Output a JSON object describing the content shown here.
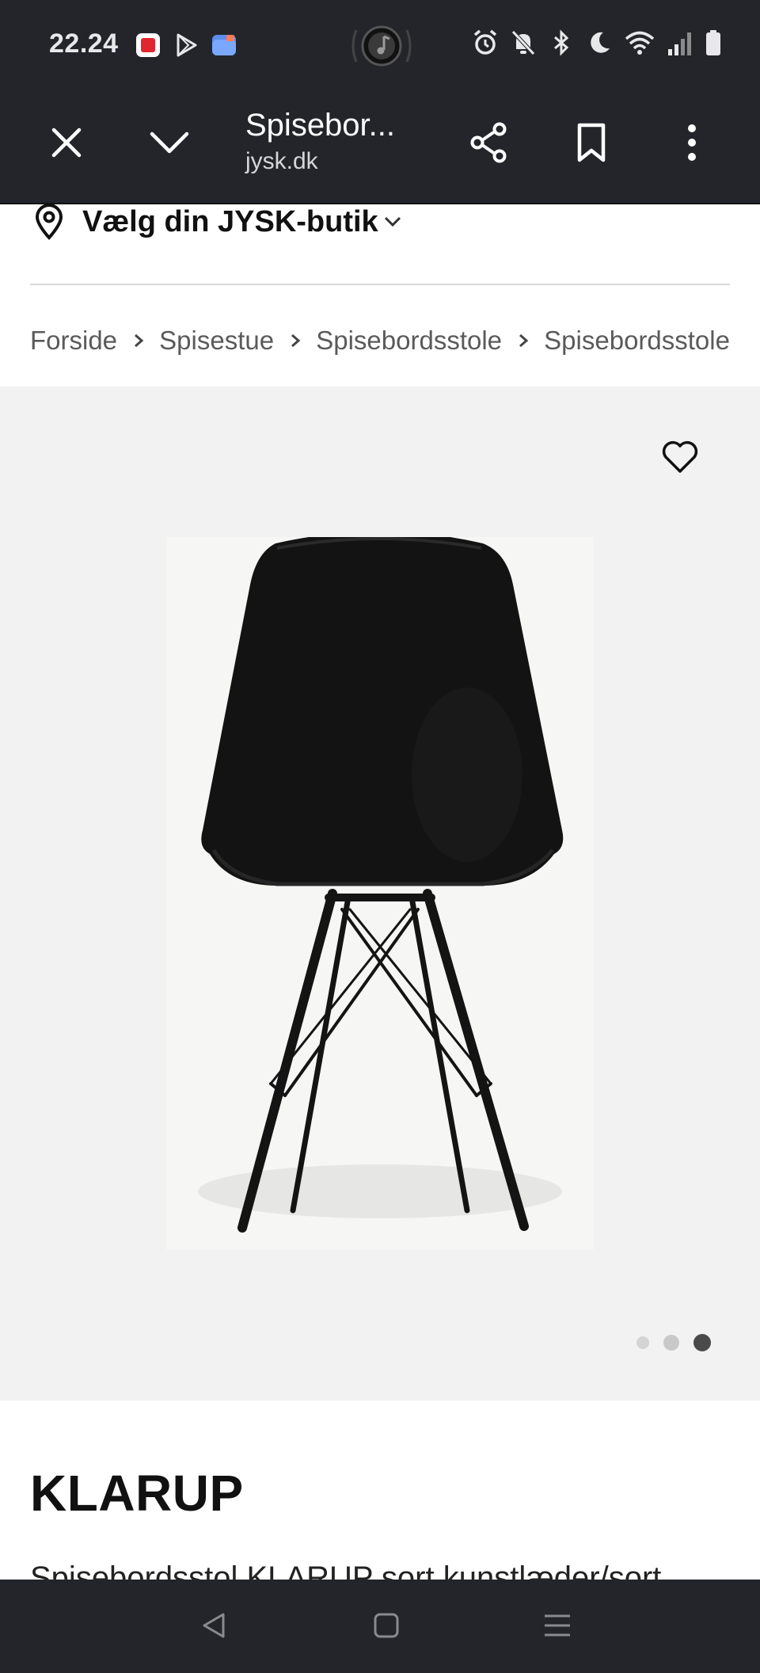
{
  "status_bar": {
    "time": "22.24",
    "notification_icons": [
      "pdf-app-icon",
      "play-store-icon",
      "files-app-icon"
    ],
    "media_icon": "music-note-icon",
    "system_icons": [
      "alarm-icon",
      "bell-off-icon",
      "bluetooth-icon",
      "moon-icon",
      "wifi-icon",
      "signal-icon",
      "battery-icon"
    ]
  },
  "browser_toolbar": {
    "title": "Spisebor...",
    "domain": "jysk.dk",
    "close_icon": "close-icon",
    "minimize_icon": "chevron-down-icon",
    "share_icon": "share-icon",
    "bookmark_icon": "bookmark-icon",
    "menu_icon": "more-vert-icon"
  },
  "store_selector": {
    "label": "Vælg din JYSK-butik",
    "icon": "location-pin-icon"
  },
  "breadcrumb": {
    "items": [
      "Forside",
      "Spisestue",
      "Spisebordsstole",
      "Spisebordsstole"
    ]
  },
  "gallery": {
    "favorite_icon": "heart-icon",
    "image_alt": "KLARUP dining chair, black",
    "total_images": 3,
    "active_index": 3
  },
  "product": {
    "name": "KLARUP",
    "description": "Spisebordsstol KLARUP sort kunstlæder/sort"
  },
  "nav_bar": {
    "back_icon": "back-triangle-icon",
    "home_icon": "home-square-icon",
    "recents_icon": "recents-lines-icon"
  },
  "colors": {
    "chrome_dark": "#23252b",
    "gallery_bg": "#f2f2f2",
    "text_primary": "#111111",
    "text_secondary": "#5a5a5a"
  }
}
